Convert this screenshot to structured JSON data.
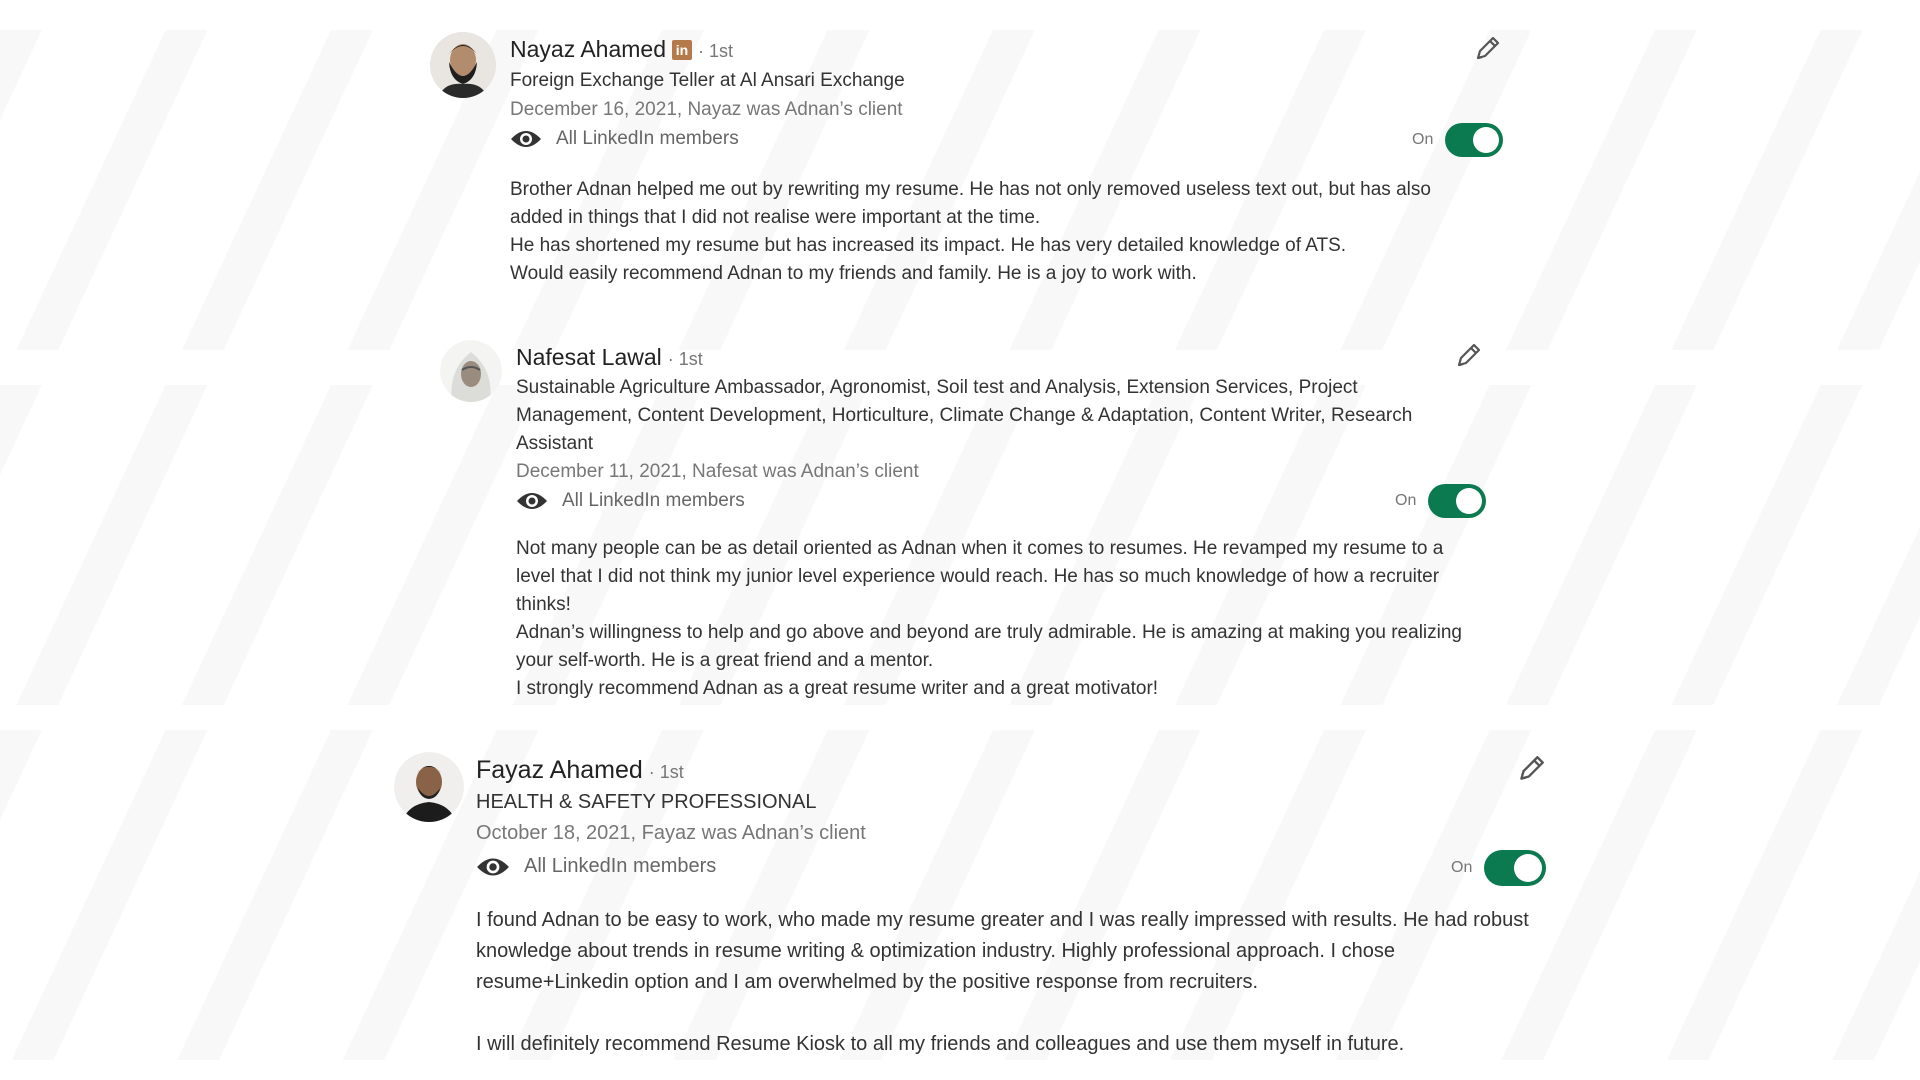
{
  "recommendations": [
    {
      "name": "Nayaz Ahamed",
      "degree": "· 1st",
      "badge": "in",
      "headline": "Foreign Exchange Teller at Al Ansari Exchange",
      "date": "December 16, 2021, Nayaz was Adnan’s client",
      "visibility": "All LinkedIn members",
      "toggle_label": "On",
      "toggle_on": true,
      "body": [
        "Brother Adnan helped me out by rewriting my resume. He has not only removed useless text out, but has also added in things that I did not realise were important at the time.",
        "He has shortened my resume but has increased its impact. He has very detailed knowledge of ATS.",
        "Would easily recommend Adnan to my friends and family. He is a joy to work with."
      ]
    },
    {
      "name": "Nafesat Lawal",
      "degree": "· 1st",
      "headline": "Sustainable Agriculture Ambassador, Agronomist, Soil test and Analysis, Extension Services, Project Management, Content Development, Horticulture, Climate Change & Adaptation, Content Writer, Research Assistant",
      "date": "December 11, 2021, Nafesat was Adnan’s client",
      "visibility": "All LinkedIn members",
      "toggle_label": "On",
      "toggle_on": true,
      "body": [
        "Not many people can be as detail oriented as Adnan when it comes to resumes. He revamped my resume to a level that I did not think my junior level experience would reach. He has so much knowledge of how a recruiter thinks!",
        "Adnan’s willingness to help and go above and beyond are truly admirable. He is amazing at making you realizing your self-worth. He is a great friend and a mentor.",
        "I strongly recommend Adnan as a great resume writer and a great motivator!"
      ]
    },
    {
      "name": "Fayaz Ahamed",
      "degree": "· 1st",
      "headline": "HEALTH & SAFETY PROFESSIONAL",
      "date": "October 18, 2021, Fayaz was Adnan’s client",
      "visibility": "All LinkedIn members",
      "toggle_label": "On",
      "toggle_on": true,
      "body": [
        "I found Adnan to be easy to work, who made my resume greater and I was really impressed with results. He had robust knowledge about trends in resume writing & optimization industry. Highly professional approach. I chose resume+Linkedin option and I am overwhelmed by the positive response from recruiters.",
        "I will definitely recommend Resume Kiosk to all my friends and colleagues and use them myself in future."
      ]
    }
  ],
  "colors": {
    "toggle_on": "#0b7a50",
    "linkedin_badge": "#b57a49",
    "muted_text": "#777777",
    "body_text": "#333333"
  },
  "icons": {
    "edit": "pencil-icon",
    "visibility": "eye-icon"
  }
}
